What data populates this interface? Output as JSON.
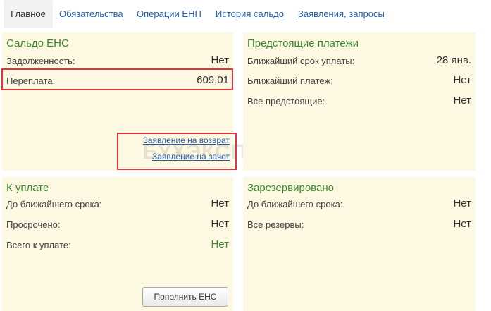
{
  "tabs": [
    {
      "label": "Главное"
    },
    {
      "label": "Обязательства"
    },
    {
      "label": "Операции ЕНП"
    },
    {
      "label": "История сальдо"
    },
    {
      "label": "Заявления, запросы"
    }
  ],
  "saldo": {
    "title": "Сальдо ЕНС",
    "debt_label": "Задолженность:",
    "debt_value": "Нет",
    "overpay_label": "Переплата:",
    "overpay_value": "609,01",
    "refund_link": "Заявление на возврат",
    "offset_link": "Заявление на зачет"
  },
  "upcoming": {
    "title": "Предстоящие платежи",
    "nearest_date_label": "Ближайший срок уплаты:",
    "nearest_date_value": "28 янв.",
    "nearest_payment_label": "Ближайший платеж:",
    "nearest_payment_value": "Нет",
    "all_label": "Все предстоящие:",
    "all_value": "Нет"
  },
  "to_pay": {
    "title": "К уплате",
    "until_label": "До ближайшего срока:",
    "until_value": "Нет",
    "overdue_label": "Просрочено:",
    "overdue_value": "Нет",
    "total_label": "Всего к уплате:",
    "total_value": "Нет",
    "button_label": "Пополнить ЕНС"
  },
  "reserved": {
    "title": "Зарезервировано",
    "until_label": "До ближайшего срока:",
    "until_value": "Нет",
    "all_label": "Все резервы:",
    "all_value": "Нет"
  },
  "watermark": "БУХЭКСПЕРТ",
  "colors": {
    "panel_bg": "#fdf8e1",
    "title_green": "#3a8a2e",
    "link_blue": "#2a5ea8",
    "highlight_red": "#e0353b"
  }
}
